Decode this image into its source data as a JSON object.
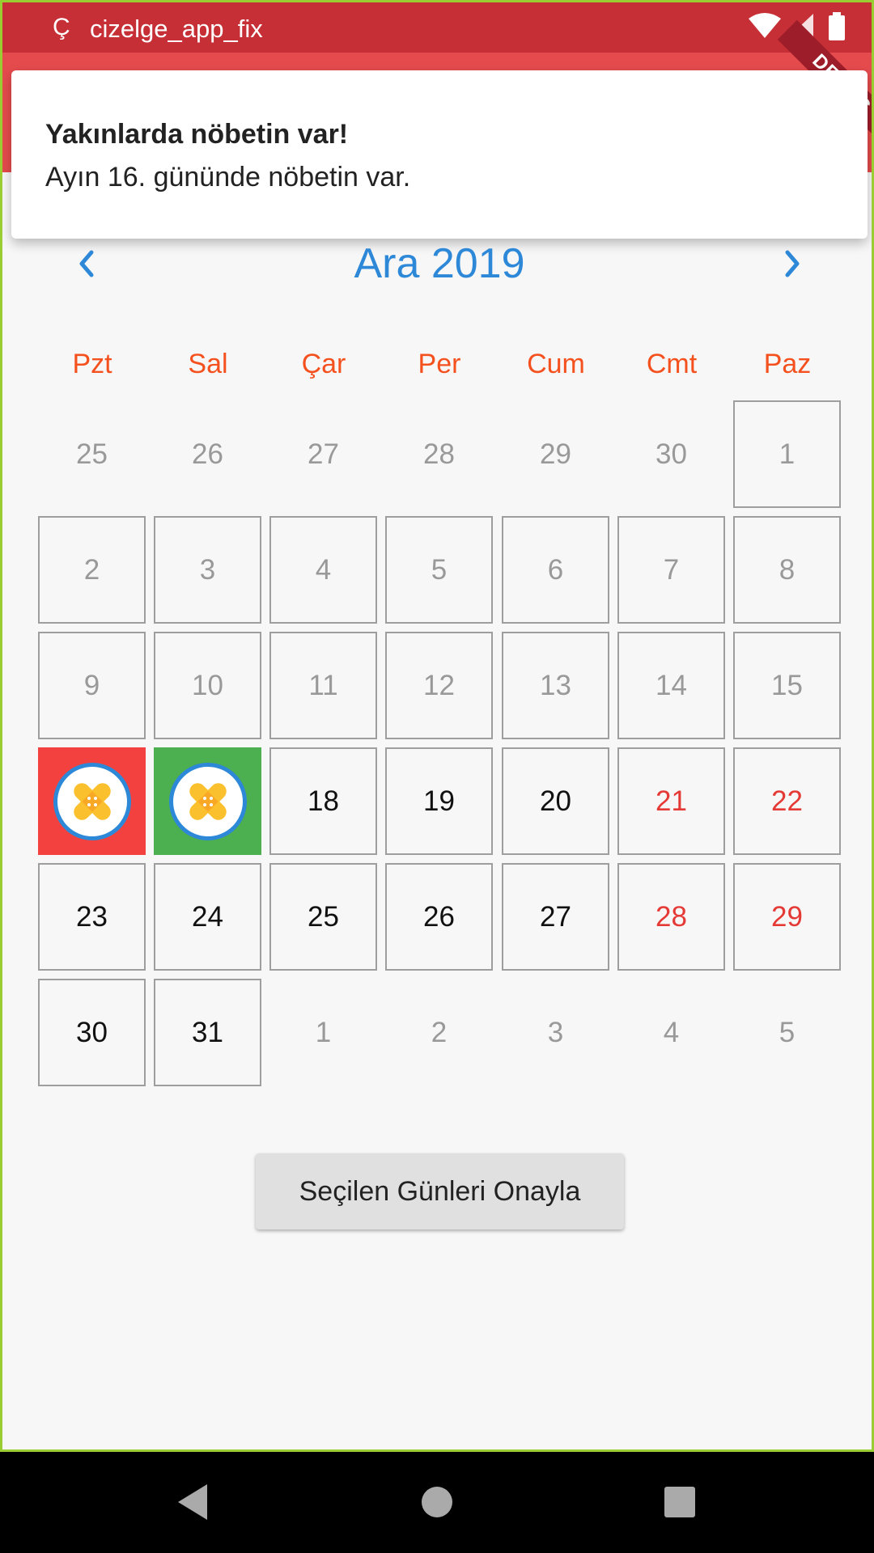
{
  "status_bar": {
    "app_icon": "Ç",
    "title": "cizelge_app_fix",
    "icons": [
      "wifi-icon",
      "signal-icon",
      "battery-icon"
    ]
  },
  "debug_banner": "DEBUG",
  "notification": {
    "title": "Yakınlarda nöbetin var!",
    "body": "Ayın 16. gününde nöbetin var."
  },
  "calendar": {
    "month_title": "Ara 2019",
    "weekdays": [
      "Pzt",
      "Sal",
      "Çar",
      "Per",
      "Cum",
      "Cmt",
      "Paz"
    ],
    "rows": [
      [
        {
          "label": "25",
          "style": "outside"
        },
        {
          "label": "26",
          "style": "outside"
        },
        {
          "label": "27",
          "style": "outside"
        },
        {
          "label": "28",
          "style": "outside"
        },
        {
          "label": "29",
          "style": "outside"
        },
        {
          "label": "30",
          "style": "outside"
        },
        {
          "label": "1",
          "style": "past"
        }
      ],
      [
        {
          "label": "2",
          "style": "past"
        },
        {
          "label": "3",
          "style": "past"
        },
        {
          "label": "4",
          "style": "past"
        },
        {
          "label": "5",
          "style": "past"
        },
        {
          "label": "6",
          "style": "past"
        },
        {
          "label": "7",
          "style": "past"
        },
        {
          "label": "8",
          "style": "past"
        }
      ],
      [
        {
          "label": "9",
          "style": "past"
        },
        {
          "label": "10",
          "style": "past"
        },
        {
          "label": "11",
          "style": "past"
        },
        {
          "label": "12",
          "style": "past"
        },
        {
          "label": "13",
          "style": "past"
        },
        {
          "label": "14",
          "style": "past"
        },
        {
          "label": "15",
          "style": "past"
        }
      ],
      [
        {
          "label": "",
          "style": "duty-red",
          "icon": "bandage-icon"
        },
        {
          "label": "",
          "style": "duty-green",
          "icon": "bandage-icon"
        },
        {
          "label": "18",
          "style": "active"
        },
        {
          "label": "19",
          "style": "active"
        },
        {
          "label": "20",
          "style": "active"
        },
        {
          "label": "21",
          "style": "weekend"
        },
        {
          "label": "22",
          "style": "weekend"
        }
      ],
      [
        {
          "label": "23",
          "style": "active"
        },
        {
          "label": "24",
          "style": "active"
        },
        {
          "label": "25",
          "style": "active"
        },
        {
          "label": "26",
          "style": "active"
        },
        {
          "label": "27",
          "style": "active"
        },
        {
          "label": "28",
          "style": "weekend"
        },
        {
          "label": "29",
          "style": "weekend"
        }
      ],
      [
        {
          "label": "30",
          "style": "active"
        },
        {
          "label": "31",
          "style": "active"
        },
        {
          "label": "1",
          "style": "outside"
        },
        {
          "label": "2",
          "style": "outside"
        },
        {
          "label": "3",
          "style": "outside"
        },
        {
          "label": "4",
          "style": "outside"
        },
        {
          "label": "5",
          "style": "outside"
        }
      ]
    ]
  },
  "confirm_button": "Seçilen Günleri Onayla",
  "colors": {
    "status_bar": "#c62f35",
    "app_bar": "#e54b4d",
    "accent_blue": "#2e88d8",
    "weekday_orange": "#f4511e",
    "weekend_red": "#e53935",
    "duty_red": "#f2413e",
    "duty_green": "#4caf50"
  }
}
